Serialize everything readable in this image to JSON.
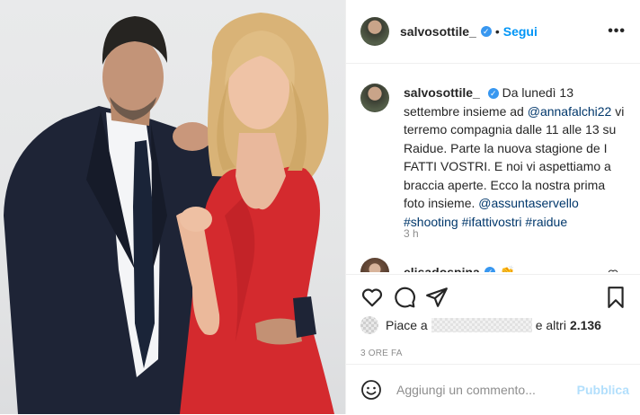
{
  "post": {
    "photo_alt": "Salvo Sottile e Anna Falchi",
    "header": {
      "username": "salvosottile_",
      "verified_icon": "verified-badge-icon",
      "separator": "•",
      "follow_label": "Segui",
      "more_label": "•••"
    },
    "caption": {
      "username": "salvosottile_",
      "text_1": "Da lunedì 13 settembre insieme ad ",
      "mention_1": "@annafalchi22",
      "text_2": " vi terremo compagnia dalle 11 alle 13 su Raidue. Parte la nuova stagione de I FATTI VOSTRI. E noi vi aspettiamo a braccia aperte. Ecco la nostra prima foto insieme. ",
      "mention_2": "@assuntaservello",
      "hashtag_1": "#shooting",
      "hashtag_2": "#ifattivostri",
      "hashtag_3": "#raidue",
      "time": "3 h"
    },
    "comment": {
      "username": "elisadospina",
      "emoji": "👏"
    },
    "likes": {
      "prefix": "Piace a",
      "suffix": "e altri",
      "count": "2.136"
    },
    "posted_ago": "3 ORE FA",
    "add_comment": {
      "placeholder": "Aggiungi un commento...",
      "publish_label": "Pubblica"
    }
  },
  "colors": {
    "accent": "#0095f6",
    "publish_disabled": "#b2dffc",
    "link": "#00376b",
    "dress": "#d42a2e"
  }
}
